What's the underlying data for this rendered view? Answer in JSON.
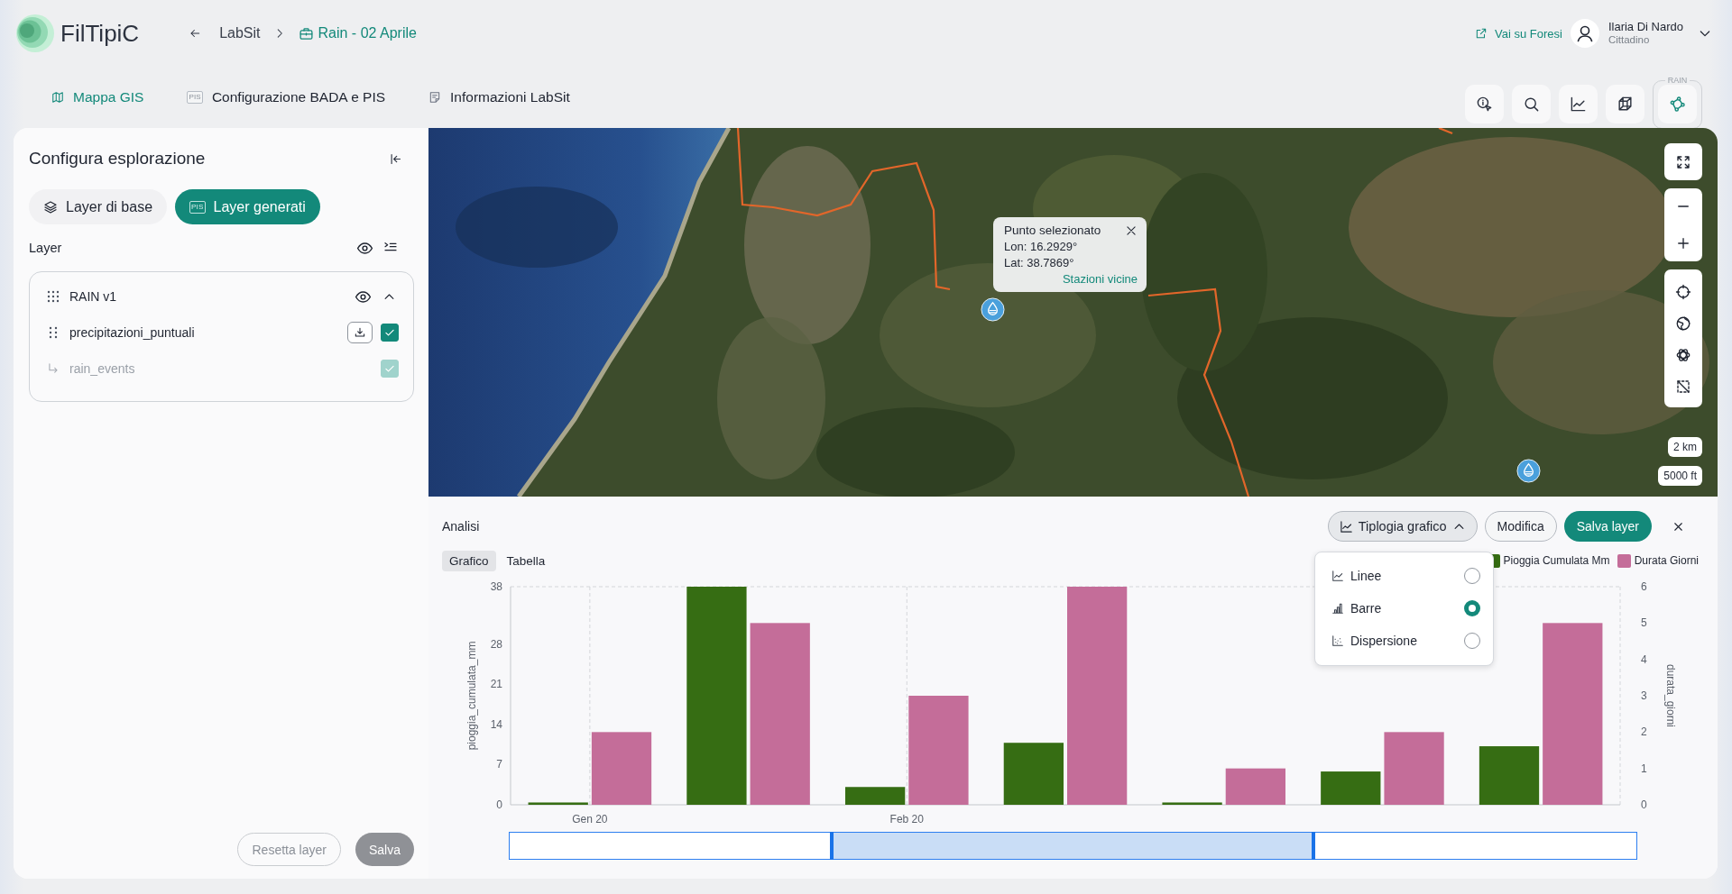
{
  "header": {
    "app_name": "FilTipiC",
    "breadcrumb": [
      {
        "label": "LabSit",
        "kind": "link"
      },
      {
        "label": "Rain - 02 Aprile",
        "kind": "current"
      }
    ],
    "external_link": "Vai su Foresi",
    "user": {
      "name": "Ilaria Di Nardo",
      "role": "Cittadino"
    }
  },
  "nav_tabs": [
    {
      "label": "Mappa GIS",
      "kind": "map",
      "selected": true
    },
    {
      "label": "Configurazione BADA e PIS",
      "kind": "badge",
      "badge": "PIS",
      "selected": false
    },
    {
      "label": "Informazioni LabSit",
      "kind": "note",
      "selected": false
    }
  ],
  "toolbar": {
    "tools": [
      {
        "kind": "info",
        "selected": false
      },
      {
        "kind": "search",
        "selected": false
      },
      {
        "kind": "chart",
        "selected": false
      },
      {
        "kind": "cube",
        "selected": false
      }
    ],
    "group": {
      "label": "RAIN",
      "tools": [
        {
          "kind": "nodes",
          "selected": true
        }
      ]
    }
  },
  "sidebar": {
    "title": "Configura esplorazione",
    "tabs": [
      {
        "label": "Layer di base",
        "kind": "layers",
        "selected": false
      },
      {
        "label": "Layer generati",
        "kind": "badge",
        "badge": "PIS",
        "selected": true
      }
    ],
    "section_label": "Layer",
    "layer_groups": [
      {
        "name": "RAIN v1",
        "visible": true,
        "expanded": true,
        "children": [
          {
            "name": "precipitazioni_puntuali",
            "checked": true,
            "disabled": false,
            "children": [
              {
                "name": "rain_events",
                "checked": true,
                "disabled": true
              }
            ]
          }
        ]
      }
    ],
    "buttons": [
      {
        "label": "Resetta layer",
        "kind": "secondary",
        "disabled": true
      },
      {
        "label": "Salva",
        "kind": "primary",
        "disabled": true
      }
    ]
  },
  "map": {
    "popup": {
      "title": "Punto selezionato",
      "lon": "Lon: 16.2929°",
      "lat": "Lat: 38.7869°",
      "link": "Stazioni vicine"
    },
    "scale": [
      "2 km",
      "5000 ft"
    ]
  },
  "analysis": {
    "title": "Analisi",
    "chart_type_button": {
      "label": "Tiplogia grafico",
      "expanded": true
    },
    "buttons": [
      {
        "label": "Modifica",
        "kind": "secondary"
      },
      {
        "label": "Salva layer",
        "kind": "primary"
      }
    ],
    "view_tabs": [
      {
        "label": "Grafico",
        "selected": true
      },
      {
        "label": "Tabella",
        "selected": false
      }
    ],
    "chart_types": [
      {
        "label": "Linee",
        "kind": "line",
        "selected": false
      },
      {
        "label": "Barre",
        "kind": "bar",
        "selected": true
      },
      {
        "label": "Dispersione",
        "kind": "scatter",
        "selected": false
      }
    ],
    "chart_data": {
      "type": "bar",
      "ylabel": "pioggia_cumulata_mm",
      "y2label": "durata_giorni",
      "categories": [
        "Gen 20",
        null,
        "Feb 20",
        null,
        null,
        null,
        null
      ],
      "ylim": [
        0,
        38
      ],
      "yticks": [
        0,
        7,
        14,
        21,
        28,
        38
      ],
      "y2lim": [
        0,
        6
      ],
      "y2ticks": [
        0,
        1,
        2,
        3,
        4,
        5,
        6
      ],
      "series": [
        {
          "name": "Pioggia Cumulata Mm",
          "color": "#366d13",
          "values": [
            0.4,
            38,
            3.1,
            10.8,
            0.4,
            5.8,
            10.2
          ]
        },
        {
          "name": "Durata Giorni",
          "color": "#c46d99",
          "axis": "y2",
          "values": [
            2,
            5,
            3,
            6,
            1,
            2,
            5
          ]
        }
      ]
    },
    "range_slider": {
      "handles": [
        {
          "level": 0.286
        },
        {
          "level": 0.713
        }
      ]
    }
  }
}
